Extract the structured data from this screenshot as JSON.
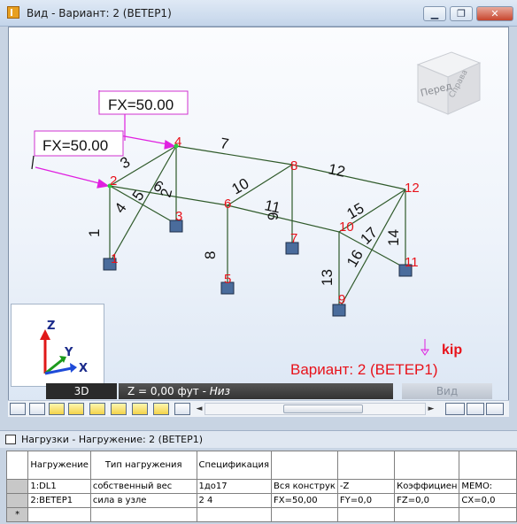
{
  "window": {
    "title": "Вид - Вариант: 2 (ВЕТЕР1)",
    "minimize_glyph": "▁",
    "restore_glyph": "❐",
    "close_glyph": "✕"
  },
  "viewcube": {
    "front": "Перед",
    "right": "Справа"
  },
  "loads": [
    {
      "label": "FX=50.00"
    },
    {
      "label": "FX=50.00"
    }
  ],
  "nodes": [
    {
      "id": "1"
    },
    {
      "id": "2"
    },
    {
      "id": "3"
    },
    {
      "id": "4"
    },
    {
      "id": "5"
    },
    {
      "id": "6"
    },
    {
      "id": "7"
    },
    {
      "id": "8"
    },
    {
      "id": "9"
    },
    {
      "id": "10"
    },
    {
      "id": "11"
    },
    {
      "id": "12"
    }
  ],
  "members": [
    {
      "id": "1"
    },
    {
      "id": "2"
    },
    {
      "id": "3"
    },
    {
      "id": "4"
    },
    {
      "id": "5"
    },
    {
      "id": "6"
    },
    {
      "id": "7"
    },
    {
      "id": "8"
    },
    {
      "id": "9"
    },
    {
      "id": "10"
    },
    {
      "id": "11"
    },
    {
      "id": "12"
    },
    {
      "id": "13"
    },
    {
      "id": "14"
    },
    {
      "id": "15"
    },
    {
      "id": "16"
    },
    {
      "id": "17"
    }
  ],
  "axes": {
    "z": "Z",
    "y": "Y",
    "x": "X"
  },
  "unit_label": "kip",
  "variant_label": "Вариант: 2 (ВЕТЕР1)",
  "viewbar": {
    "mode": "3D",
    "level_prefix": "Z = 0,00 фут - ",
    "level_name": "Низ",
    "view_button": "Вид"
  },
  "toolbar": {
    "icon_names": [
      "frame-icon",
      "portal-icon",
      "slab-icon",
      "roof-icon",
      "brace-icon",
      "stair-icon",
      "plate-icon",
      "wall-icon",
      "grid-icon"
    ]
  },
  "panel": {
    "title": "Нагрузки - Нагружение: 2 (ВЕТЕР1)"
  },
  "table": {
    "headers": [
      "",
      "Нагружение",
      "Тип нагружения",
      "Спецификация",
      "",
      "",
      "",
      ""
    ],
    "rows": [
      [
        "",
        "1:DL1",
        "собственный вес",
        "1до17",
        "Вся конструк",
        "-Z",
        "Коэффициен",
        "MEMO:"
      ],
      [
        "",
        "2:ВЕТЕР1",
        "сила в узле",
        "2 4",
        "FX=50,00",
        "FY=0,0",
        "FZ=0,0",
        "CX=0,0"
      ],
      [
        "*",
        "",
        "",
        "",
        "",
        "",
        "",
        ""
      ]
    ]
  },
  "colors": {
    "accent": "#e8121a",
    "member": "#2f5a2a",
    "load": "#e020e0",
    "support": "#3d5a8a"
  }
}
